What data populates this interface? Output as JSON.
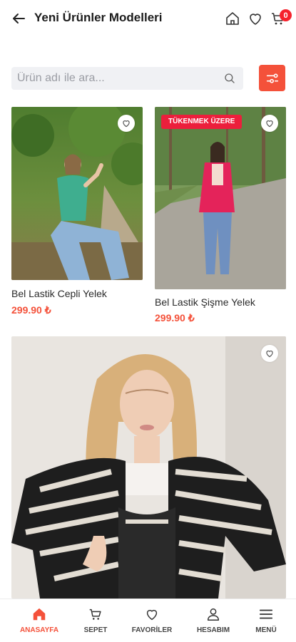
{
  "header": {
    "title": "Yeni Ürünler Modelleri",
    "cart_count": "0"
  },
  "search": {
    "placeholder": "Ürün adı ile ara..."
  },
  "products": [
    {
      "name": "Bel Lastik Cepli Yelek",
      "price": "299.90 ₺",
      "badge": ""
    },
    {
      "name": "Bel Lastik Şişme Yelek",
      "price": "299.90 ₺",
      "badge": "TÜKENMEK ÜZERE"
    },
    {
      "name": "",
      "price": "",
      "badge": ""
    }
  ],
  "bottom_nav": [
    {
      "label": "ANASAYFA",
      "icon": "home-icon",
      "active": true
    },
    {
      "label": "SEPET",
      "icon": "cart-icon",
      "active": false
    },
    {
      "label": "FAVORİLER",
      "icon": "heart-icon",
      "active": false
    },
    {
      "label": "HESABIM",
      "icon": "user-icon",
      "active": false
    },
    {
      "label": "MENÜ",
      "icon": "menu-icon",
      "active": false
    }
  ],
  "colors": {
    "accent": "#f4513a",
    "badge": "#ec1f3c",
    "cart_badge": "#f5222d"
  }
}
